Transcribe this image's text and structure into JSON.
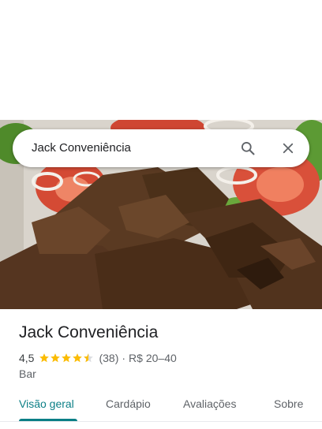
{
  "search": {
    "query": "Jack Conveniência"
  },
  "place": {
    "name": "Jack Conveniência",
    "rating": "4,5",
    "rating_value": 4.5,
    "reviews": "(38)",
    "separator": "·",
    "price": "R$ 20–40",
    "category": "Bar"
  },
  "tabs": [
    {
      "label": "Visão geral",
      "active": true
    },
    {
      "label": "Cardápio",
      "active": false
    },
    {
      "label": "Avaliações",
      "active": false
    },
    {
      "label": "Sobre",
      "active": false
    }
  ],
  "colors": {
    "accent": "#0b7f86",
    "star": "#fbbc04"
  }
}
